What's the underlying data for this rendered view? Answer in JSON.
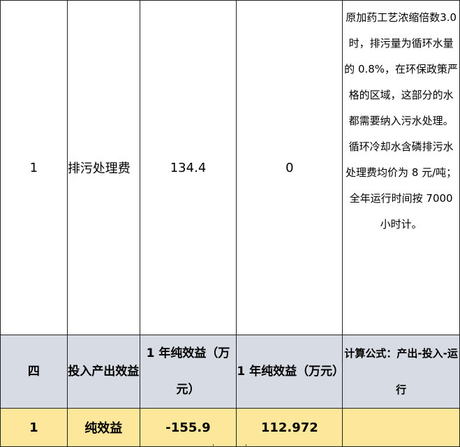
{
  "rows": [
    {
      "no": "1",
      "item": "排污处理费",
      "value_a": "134.4",
      "value_b": "0",
      "note": "原加药工艺浓缩倍数3.0 时，排污量为循环水量的 0.8%，在环保政策严格的区域，这部分的水都需要纳入污水处理。循环冷却水含磷排污水处理费均价为 8 元/吨；全年运行时间按 7000 小时计。"
    }
  ],
  "section": {
    "no": "四",
    "item": "投入产出效益",
    "value_a": "1 年纯效益（万元）",
    "value_b": "1 年纯效益（万元）",
    "note": "计算公式：产出-投入-运行"
  },
  "summary": {
    "no": "1",
    "item": "纯效益",
    "value_a": "-155.9",
    "value_b": "112.972",
    "note": ""
  },
  "colors": {
    "section_bg": "#d7dbe3",
    "summary_bg": "#fde79a",
    "border": "#222222"
  }
}
